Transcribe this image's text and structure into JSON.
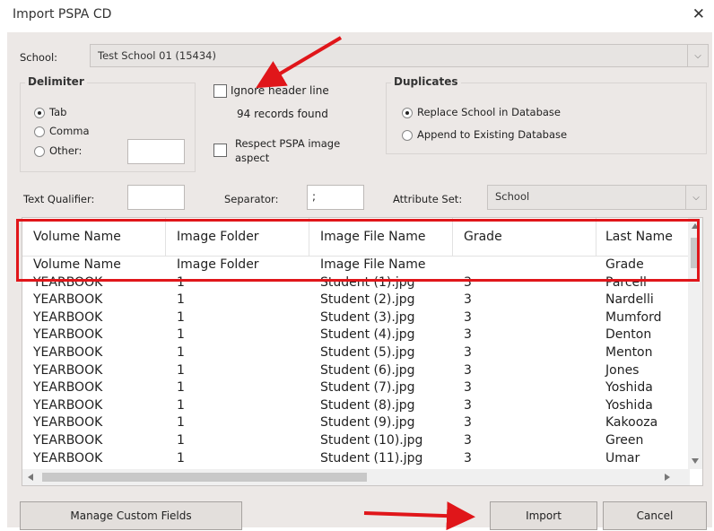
{
  "window": {
    "title": "Import PSPA CD",
    "close_glyph": "✕"
  },
  "school": {
    "label": "School:",
    "value": "Test School 01 (15434)"
  },
  "delimiter": {
    "title": "Delimiter",
    "options": [
      {
        "label": "Tab",
        "selected": true
      },
      {
        "label": "Comma",
        "selected": false
      },
      {
        "label": "Other:",
        "selected": false
      }
    ],
    "other_value": ""
  },
  "header_option": {
    "ignore_label": "Ignore header line",
    "ignore_checked": false,
    "records_found": "94 records found"
  },
  "respect_option": {
    "label_line1": "Respect PSPA image",
    "label_line2": "aspect",
    "checked": false
  },
  "duplicates": {
    "title": "Duplicates",
    "options": [
      {
        "label": "Replace School in Database",
        "selected": true
      },
      {
        "label": "Append to Existing Database",
        "selected": false
      }
    ]
  },
  "text_qualifier": {
    "label": "Text Qualifier:",
    "value": ""
  },
  "separator": {
    "label": "Separator:",
    "value": ";"
  },
  "attribute_set": {
    "label": "Attribute Set:",
    "value": "School"
  },
  "table": {
    "columns": [
      "Volume Name",
      "Image Folder",
      "Image File Name",
      "Grade",
      "Last Name"
    ],
    "rows": [
      [
        "Volume Name",
        "Image Folder",
        "Image File Name",
        "",
        "Grade"
      ],
      [
        "YEARBOOK",
        "1",
        "Student (1).jpg",
        "3",
        "Parcell"
      ],
      [
        "YEARBOOK",
        "1",
        "Student (2).jpg",
        "3",
        "Nardelli"
      ],
      [
        "YEARBOOK",
        "1",
        "Student (3).jpg",
        "3",
        "Mumford"
      ],
      [
        "YEARBOOK",
        "1",
        "Student (4).jpg",
        "3",
        "Denton"
      ],
      [
        "YEARBOOK",
        "1",
        "Student (5).jpg",
        "3",
        "Menton"
      ],
      [
        "YEARBOOK",
        "1",
        "Student (6).jpg",
        "3",
        "Jones"
      ],
      [
        "YEARBOOK",
        "1",
        "Student (7).jpg",
        "3",
        "Yoshida"
      ],
      [
        "YEARBOOK",
        "1",
        "Student (8).jpg",
        "3",
        "Yoshida"
      ],
      [
        "YEARBOOK",
        "1",
        "Student (9).jpg",
        "3",
        "Kakooza"
      ],
      [
        "YEARBOOK",
        "1",
        "Student (10).jpg",
        "3",
        "Green"
      ],
      [
        "YEARBOOK",
        "1",
        "Student (11).jpg",
        "3",
        "Umar"
      ]
    ]
  },
  "buttons": {
    "manage": "Manage Custom Fields",
    "import": "Import",
    "cancel": "Cancel"
  },
  "colors": {
    "annotation_red": "#e0161a",
    "dialog_bg": "#ece8e6"
  },
  "icons": {
    "dropdown": "chevron-down-icon",
    "close": "close-icon",
    "arrow_annotation": "red-arrow-annotation"
  }
}
